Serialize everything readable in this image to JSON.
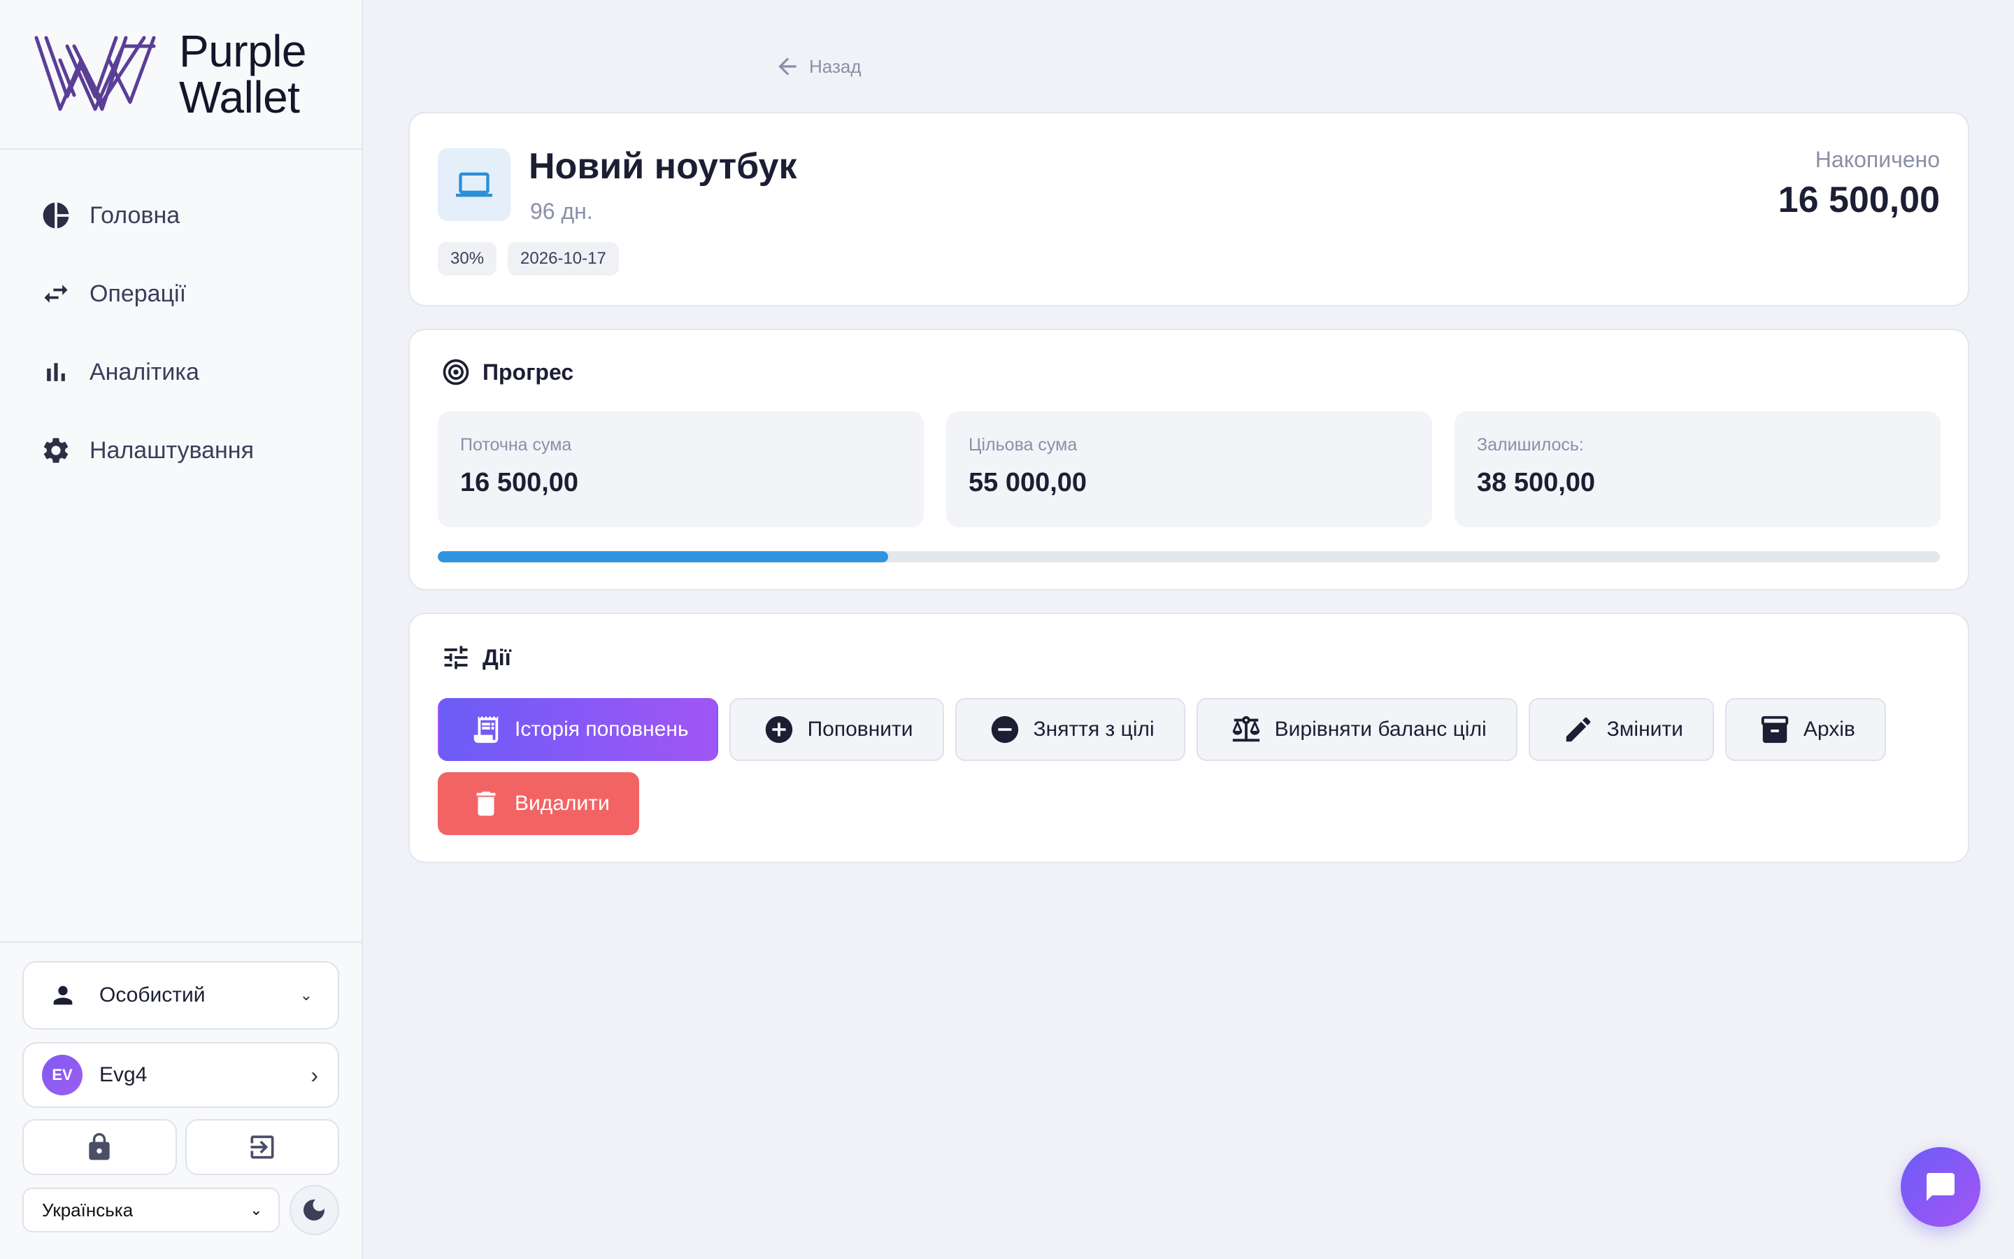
{
  "brand": {
    "line1": "Purple",
    "line2": "Wallet",
    "logo_color": "#5b3e96"
  },
  "nav": {
    "items": [
      {
        "label": "Головна",
        "icon": "pie-chart-icon"
      },
      {
        "label": "Операції",
        "icon": "swap-arrows-icon"
      },
      {
        "label": "Аналітика",
        "icon": "bar-chart-icon"
      },
      {
        "label": "Налаштування",
        "icon": "gear-icon"
      }
    ]
  },
  "sidebar_bottom": {
    "account": "Особистий",
    "user": {
      "initials": "EV",
      "name": "Evg4"
    },
    "language": "Українська"
  },
  "back": {
    "label": "Назад"
  },
  "goal": {
    "title": "Новий ноутбук",
    "days_left": "96 дн.",
    "percent_chip": "30%",
    "date_chip": "2026-10-17",
    "saved_label": "Накопичено",
    "saved_value": "16 500,00",
    "icon": "laptop-icon"
  },
  "progress": {
    "title": "Прогрес",
    "current_label": "Поточна сума",
    "current_value": "16 500,00",
    "target_label": "Цільова сума",
    "target_value": "55 000,00",
    "remaining_label": "Залишилось:",
    "remaining_value": "38 500,00",
    "fill_percent": 30,
    "bar_color": "#2f95e0"
  },
  "actions": {
    "title": "Дії",
    "history": "Історія поповнень",
    "deposit": "Поповнити",
    "withdraw": "Зняття з цілі",
    "balance": "Вирівняти баланс цілі",
    "edit": "Змінити",
    "archive": "Архів",
    "delete": "Видалити"
  },
  "colors": {
    "primary_gradient_start": "#6c5cf6",
    "primary_gradient_end": "#a056f5",
    "danger": "#f26464"
  }
}
